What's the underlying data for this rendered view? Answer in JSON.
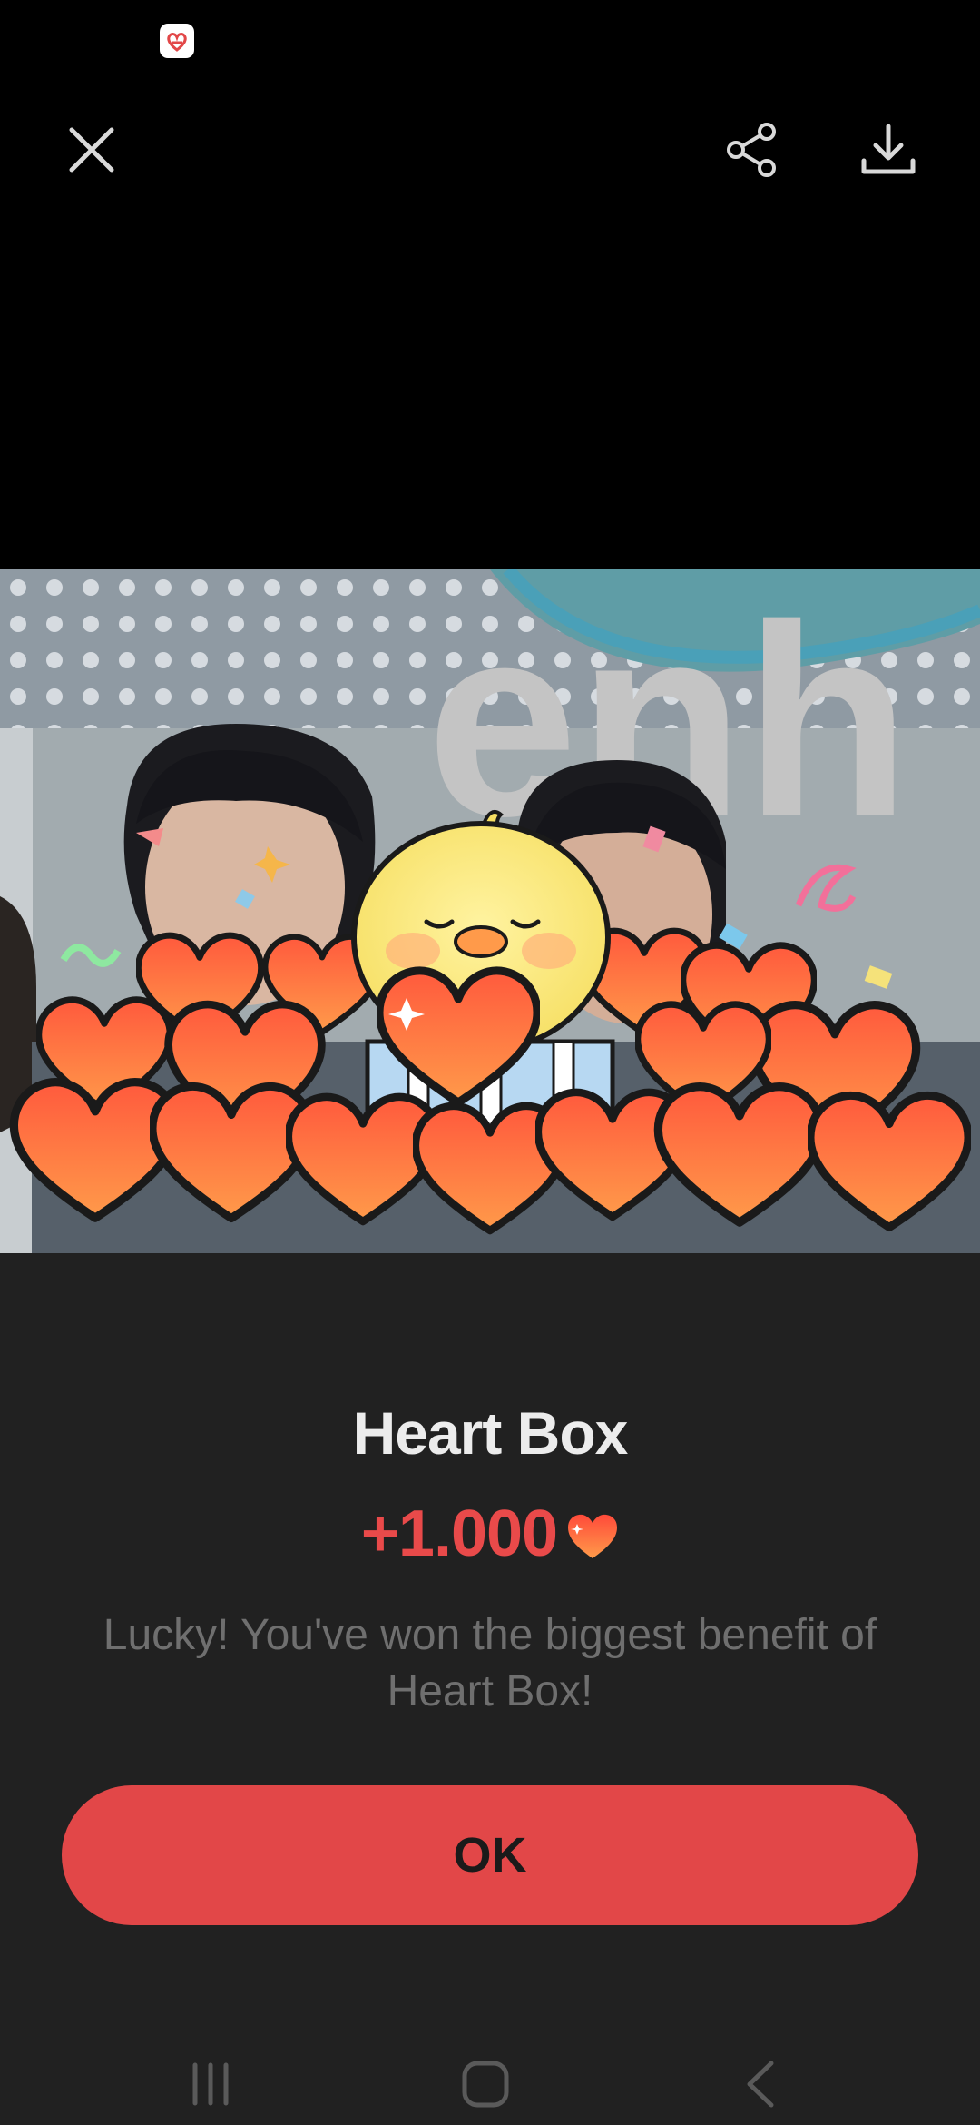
{
  "status_bar": {
    "notification_icon": "heart-app-notification-icon"
  },
  "toolbar": {
    "close_icon": "close-icon",
    "share_icon": "share-icon",
    "download_icon": "download-icon"
  },
  "media": {
    "background_text": "enh"
  },
  "dialog": {
    "title": "Heart Box",
    "reward_amount": "+1.000",
    "reward_icon": "heart-icon",
    "message": "Lucky! You've won the biggest benefit of Heart Box!",
    "ok_label": "OK"
  },
  "colors": {
    "accent": "#e24748",
    "reward_text": "#e94a4a",
    "sheet_bg": "#212121"
  },
  "nav_bar": {
    "recents_icon": "recents-icon",
    "home_icon": "home-icon",
    "back_icon": "back-icon"
  }
}
